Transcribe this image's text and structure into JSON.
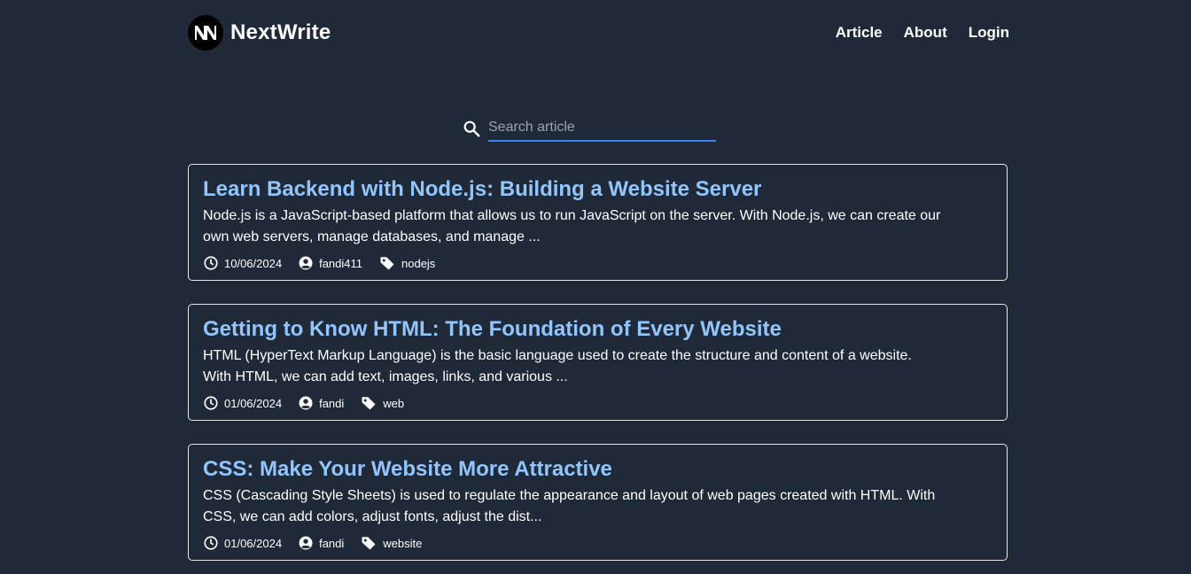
{
  "header": {
    "brand": "NextWrite",
    "logo_letters": "NN",
    "nav": [
      "Article",
      "About",
      "Login"
    ]
  },
  "search": {
    "placeholder": "Search article"
  },
  "articles": [
    {
      "title": "Learn Backend with Node.js: Building a Website Server",
      "excerpt_line1": "Node.js is a JavaScript-based platform that allows us to run JavaScript on the server. With Node.js, we can create our",
      "excerpt_line2": "own web servers, manage databases, and manage ...",
      "date": "10/06/2024",
      "author": "fandi411",
      "tag": "nodejs"
    },
    {
      "title": "Getting to Know HTML: The Foundation of Every Website",
      "excerpt_line1": "HTML (HyperText Markup Language) is the basic language used to create the structure and content of a website.",
      "excerpt_line2": "With HTML, we can add text, images, links, and various ...",
      "date": "01/06/2024",
      "author": "fandi",
      "tag": "web"
    },
    {
      "title": "CSS: Make Your Website More Attractive",
      "excerpt_line1": "CSS (Cascading Style Sheets) is used to regulate the appearance and layout of web pages created with HTML. With",
      "excerpt_line2": "CSS, we can add colors, adjust fonts, adjust the dist...",
      "date": "01/06/2024",
      "author": "fandi",
      "tag": "website"
    }
  ],
  "colors": {
    "background": "#1f2937",
    "title": "#93c5fd",
    "search_underline": "#3b82f6",
    "card_border": "#e5e7eb"
  },
  "icons": [
    "search-icon",
    "clock-icon",
    "user-icon",
    "tag-icon"
  ]
}
